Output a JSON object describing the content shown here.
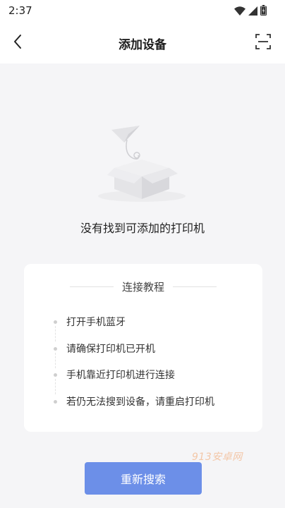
{
  "status_bar": {
    "time": "2:37"
  },
  "nav": {
    "title": "添加设备",
    "back_icon": "chevron-left-icon",
    "scan_icon": "scan-icon"
  },
  "empty_state": {
    "message": "没有找到可添加的打印机",
    "illustration": "empty-box-paper-plane-illustration"
  },
  "tutorial": {
    "title": "连接教程",
    "steps": [
      "打开手机蓝牙",
      "请确保打印机已开机",
      "手机靠近打印机进行连接",
      "若仍无法搜到设备，请重启打印机"
    ]
  },
  "watermark": "913安卓网",
  "actions": {
    "research_label": "重新搜索"
  },
  "colors": {
    "primary_button": "#6c8fe8",
    "background": "#f5f5f7",
    "card": "#ffffff"
  }
}
